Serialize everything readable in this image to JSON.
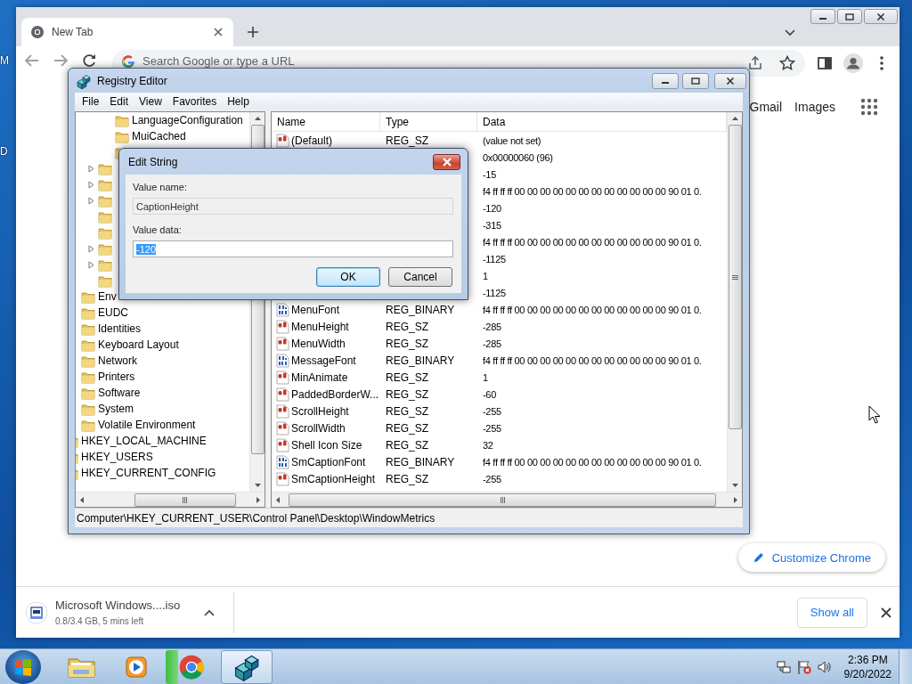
{
  "desktop": {
    "icon_labels": [
      "M",
      "D"
    ]
  },
  "browser": {
    "tab": {
      "title": "New Tab",
      "selected": true
    },
    "omnibox": {
      "placeholder": "Search Google or type a URL"
    },
    "top_links": [
      "Gmail",
      "Images"
    ],
    "customize_button": "Customize Chrome",
    "download": {
      "file_name": "Microsoft Windows....iso",
      "status": "0.8/3.4 GB, 5 mins left"
    },
    "show_all_button": "Show all"
  },
  "registry_editor": {
    "title": "Registry Editor",
    "menu": [
      "File",
      "Edit",
      "View",
      "Favorites",
      "Help"
    ],
    "tree": [
      {
        "kind": "parent",
        "children": [
          {
            "kind": "parent",
            "children": [
              {
                "kind": "parent",
                "children": [
                  {
                    "kind": "folder",
                    "label": "LanguageConfiguration",
                    "expandable": false
                  },
                  {
                    "kind": "folder",
                    "label": "MuiCached",
                    "expandable": false
                  },
                  {
                    "kind": "folder",
                    "expandable": false
                  }
                ]
              },
              {
                "kind": "folder",
                "expandable": true
              },
              {
                "kind": "folder",
                "expandable": true
              },
              {
                "kind": "folder",
                "expandable": true
              },
              {
                "kind": "folder",
                "expandable": false
              },
              {
                "kind": "folder",
                "expandable": false
              },
              {
                "kind": "folder",
                "expandable": true
              },
              {
                "kind": "folder",
                "expandable": true
              },
              {
                "kind": "folder",
                "expandable": false
              }
            ]
          },
          {
            "kind": "folder",
            "label": "Env",
            "expandable": false
          },
          {
            "kind": "folder",
            "label": "EUDC",
            "expandable": false
          },
          {
            "kind": "folder",
            "label": "Identities",
            "expandable": false
          },
          {
            "kind": "folder",
            "label": "Keyboard Layout",
            "expandable": false
          },
          {
            "kind": "folder",
            "label": "Network",
            "expandable": false
          },
          {
            "kind": "folder",
            "label": "Printers",
            "expandable": false
          },
          {
            "kind": "folder",
            "label": "Software",
            "expandable": false
          },
          {
            "kind": "folder",
            "label": "System",
            "expandable": false
          },
          {
            "kind": "folder",
            "label": "Volatile Environment",
            "expandable": false
          }
        ]
      },
      {
        "kind": "folder",
        "label": "HKEY_LOCAL_MACHINE",
        "expandable": false
      },
      {
        "kind": "folder",
        "label": "HKEY_USERS",
        "expandable": false
      },
      {
        "kind": "folder",
        "label": "HKEY_CURRENT_CONFIG",
        "expandable": false
      }
    ],
    "columns": [
      "Name",
      "Type",
      "Data"
    ],
    "rows": [
      {
        "kind": "string",
        "name": "(Default)",
        "type": "REG_SZ",
        "data": "(value not set)"
      },
      {
        "data": "0x00000060 (96)"
      },
      {
        "data": "-15"
      },
      {
        "data": "f4 ff ff ff 00 00 00 00 00 00 00 00 00 00 00 00 90 01 0."
      },
      {
        "data": "-120"
      },
      {
        "data": "-315"
      },
      {
        "data": "f4 ff ff ff 00 00 00 00 00 00 00 00 00 00 00 00 90 01 0."
      },
      {
        "data": "-1125"
      },
      {
        "data": "1"
      },
      {
        "data": "-1125"
      },
      {
        "kind": "binary",
        "name": "MenuFont",
        "type": "REG_BINARY",
        "data": "f4 ff ff ff 00 00 00 00 00 00 00 00 00 00 00 00 90 01 0."
      },
      {
        "kind": "string",
        "name": "MenuHeight",
        "type": "REG_SZ",
        "data": "-285"
      },
      {
        "kind": "string",
        "name": "MenuWidth",
        "type": "REG_SZ",
        "data": "-285"
      },
      {
        "kind": "binary",
        "name": "MessageFont",
        "type": "REG_BINARY",
        "data": "f4 ff ff ff 00 00 00 00 00 00 00 00 00 00 00 00 90 01 0."
      },
      {
        "kind": "string",
        "name": "MinAnimate",
        "type": "REG_SZ",
        "data": "1"
      },
      {
        "kind": "string",
        "name": "PaddedBorderW...",
        "type": "REG_SZ",
        "data": "-60"
      },
      {
        "kind": "string",
        "name": "ScrollHeight",
        "type": "REG_SZ",
        "data": "-255"
      },
      {
        "kind": "string",
        "name": "ScrollWidth",
        "type": "REG_SZ",
        "data": "-255"
      },
      {
        "kind": "string",
        "name": "Shell Icon Size",
        "type": "REG_SZ",
        "data": "32"
      },
      {
        "kind": "binary",
        "name": "SmCaptionFont",
        "type": "REG_BINARY",
        "data": "f4 ff ff ff 00 00 00 00 00 00 00 00 00 00 00 00 90 01 0."
      },
      {
        "kind": "string",
        "name": "SmCaptionHeight",
        "type": "REG_SZ",
        "data": "-255"
      }
    ],
    "status_bar": "Computer\\HKEY_CURRENT_USER\\Control Panel\\Desktop\\WindowMetrics"
  },
  "edit_string_dialog": {
    "title": "Edit String",
    "value_name_label": "Value name:",
    "value_name": "CaptionHeight",
    "value_data_label": "Value data:",
    "value_data": "-120",
    "buttons": [
      {
        "label": "OK",
        "kind": "default"
      },
      {
        "label": "Cancel",
        "kind": "normal"
      }
    ]
  },
  "taskbar": {
    "apps": [
      {
        "kind": "explorer",
        "selected": false
      },
      {
        "kind": "media",
        "selected": false
      },
      {
        "kind": "chrome",
        "selected": false,
        "level": 0.24
      },
      {
        "kind": "regedit",
        "selected": true
      }
    ],
    "time": "2:36 PM",
    "date": "9/20/2022"
  }
}
